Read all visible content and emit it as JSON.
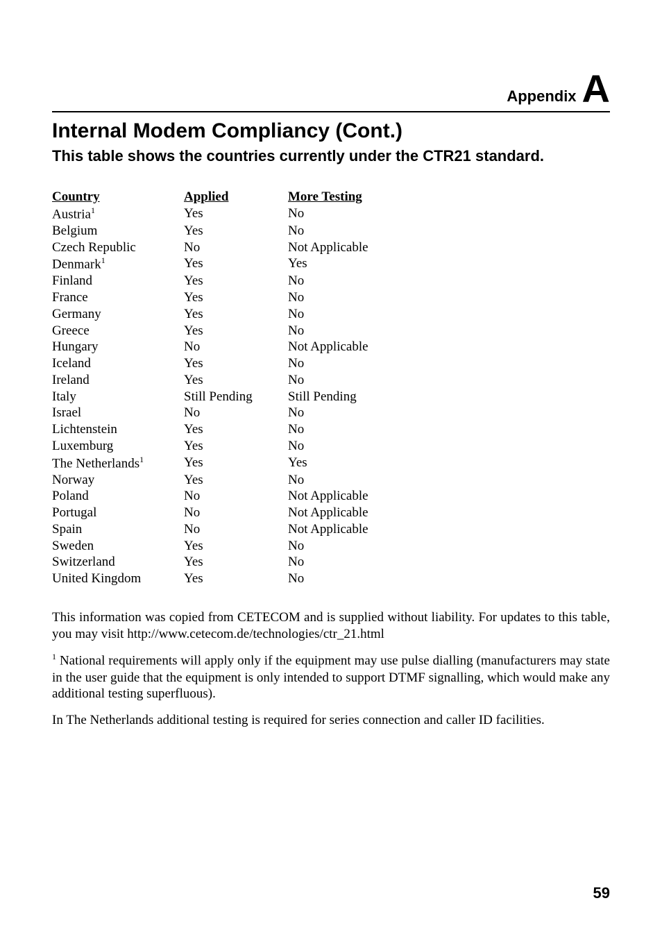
{
  "header": {
    "appendix_label": "Appendix",
    "appendix_letter": "A"
  },
  "title": "Internal Modem Compliancy (Cont.)",
  "subtitle": "This table shows the countries currently under the CTR21 standard.",
  "table": {
    "headers": {
      "country": "Country",
      "applied": "Applied",
      "more": "More Testing"
    },
    "rows": [
      {
        "country": "Austria",
        "sup": "1",
        "applied": "Yes",
        "more": "No"
      },
      {
        "country": "Belgium",
        "sup": "",
        "applied": "Yes",
        "more": "No"
      },
      {
        "country": "Czech Republic",
        "sup": "",
        "applied": "No",
        "more": "Not Applicable"
      },
      {
        "country": "Denmark",
        "sup": "1",
        "applied": "Yes",
        "more": "Yes"
      },
      {
        "country": "Finland",
        "sup": "",
        "applied": "Yes",
        "more": "No"
      },
      {
        "country": "France",
        "sup": "",
        "applied": "Yes",
        "more": "No"
      },
      {
        "country": "Germany",
        "sup": "",
        "applied": "Yes",
        "more": "No"
      },
      {
        "country": "Greece",
        "sup": "",
        "applied": "Yes",
        "more": "No"
      },
      {
        "country": "Hungary",
        "sup": "",
        "applied": "No",
        "more": "Not Applicable"
      },
      {
        "country": "Iceland",
        "sup": "",
        "applied": "Yes",
        "more": "No"
      },
      {
        "country": "Ireland",
        "sup": "",
        "applied": "Yes",
        "more": "No"
      },
      {
        "country": "Italy",
        "sup": "",
        "applied": "Still Pending",
        "more": "Still Pending"
      },
      {
        "country": "Israel",
        "sup": "",
        "applied": "No",
        "more": "No"
      },
      {
        "country": "Lichtenstein",
        "sup": "",
        "applied": "Yes",
        "more": "No"
      },
      {
        "country": "Luxemburg",
        "sup": "",
        "applied": "Yes",
        "more": "No"
      },
      {
        "country": "The Netherlands",
        "sup": "1",
        "applied": "Yes",
        "more": "Yes"
      },
      {
        "country": "Norway",
        "sup": "",
        "applied": "Yes",
        "more": "No"
      },
      {
        "country": "Poland",
        "sup": "",
        "applied": "No",
        "more": "Not Applicable"
      },
      {
        "country": "Portugal",
        "sup": "",
        "applied": "No",
        "more": "Not Applicable"
      },
      {
        "country": "Spain",
        "sup": "",
        "applied": "No",
        "more": "Not Applicable"
      },
      {
        "country": "Sweden",
        "sup": "",
        "applied": "Yes",
        "more": "No"
      },
      {
        "country": "Switzerland",
        "sup": "",
        "applied": "Yes",
        "more": "No"
      },
      {
        "country": "United Kingdom",
        "sup": "",
        "applied": "Yes",
        "more": "No"
      }
    ]
  },
  "para1": "This information was copied from CETECOM and is supplied without liability. For updates to this table, you may visit http://www.cetecom.de/technologies/ctr_21.html",
  "footnote_sup": "1",
  "footnote_rest": " National requirements will apply only if the equipment may use pulse dialling (manufacturers may state in the user guide that the equipment is only intended to support DTMF signalling, which would make any additional testing superfluous).",
  "para3": "In The Netherlands additional testing is required for series connection and caller ID facilities.",
  "page_number": "59"
}
